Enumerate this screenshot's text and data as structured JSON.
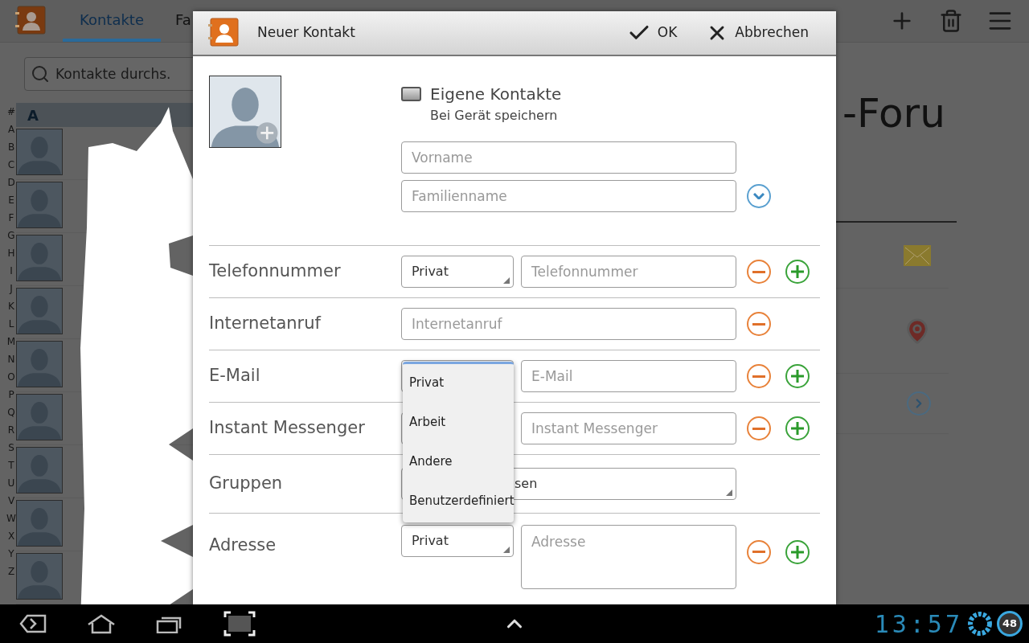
{
  "background": {
    "tabs": [
      {
        "label": "Kontakte",
        "selected": true
      },
      {
        "label": "Fa",
        "selected": false
      }
    ],
    "search": {
      "placeholder": "Kontakte durchs."
    },
    "index": [
      "#",
      "A",
      "B",
      "C",
      "D",
      "E",
      "F",
      "G",
      "H",
      "I",
      "J",
      "K",
      "L",
      "M",
      "N",
      "O",
      "P",
      "Q",
      "R",
      "S",
      "T",
      "U",
      "V",
      "W",
      "X",
      "Y",
      "Z"
    ],
    "list_header": "A",
    "contacts": [
      {
        "kind": "avatar"
      },
      {
        "kind": "avatar"
      },
      {
        "kind": "avatar"
      },
      {
        "kind": "avatar"
      },
      {
        "kind": "avatar"
      },
      {
        "kind": "avatar"
      },
      {
        "kind": "avatar"
      },
      {
        "kind": "avatar"
      },
      {
        "kind": "avatar"
      }
    ],
    "detail_title": "-Foru",
    "detail_actions": [
      {
        "kind": "email"
      },
      {
        "kind": "map"
      },
      {
        "kind": "more"
      }
    ]
  },
  "dialog": {
    "title": "Neuer Kontakt",
    "actions": [
      {
        "kind": "confirm",
        "label": "OK"
      },
      {
        "kind": "cancel",
        "label": "Abbrechen"
      }
    ],
    "account": {
      "name": "Eigene Kontakte",
      "subtitle": "Bei Gerät speichern"
    },
    "name_fields": [
      {
        "placeholder": "Vorname"
      },
      {
        "placeholder": "Familienname"
      }
    ],
    "rows": [
      {
        "kind": "typed",
        "label": "Telefonnummer",
        "type": "Privat",
        "placeholder": "Telefonnummer",
        "addable": true
      },
      {
        "kind": "plain",
        "label": "Internetanruf",
        "placeholder": "Internetanruf",
        "addable": false
      },
      {
        "kind": "typed",
        "label": "E-Mail",
        "placeholder": "E-Mail",
        "addable": true
      },
      {
        "kind": "typed",
        "label": "Instant Messenger",
        "placeholder": "Instant Messenger",
        "addable": true
      },
      {
        "kind": "group",
        "label": "Gruppen",
        "value": "sen"
      },
      {
        "kind": "address",
        "label": "Adresse",
        "type": "Privat",
        "placeholder": "Adresse",
        "addable": true
      }
    ],
    "dropdown": {
      "options": [
        "Privat",
        "Arbeit",
        "Andere",
        "Benutzerdefiniert"
      ]
    }
  },
  "nav": {
    "clock": "13:57",
    "battery": "48"
  }
}
